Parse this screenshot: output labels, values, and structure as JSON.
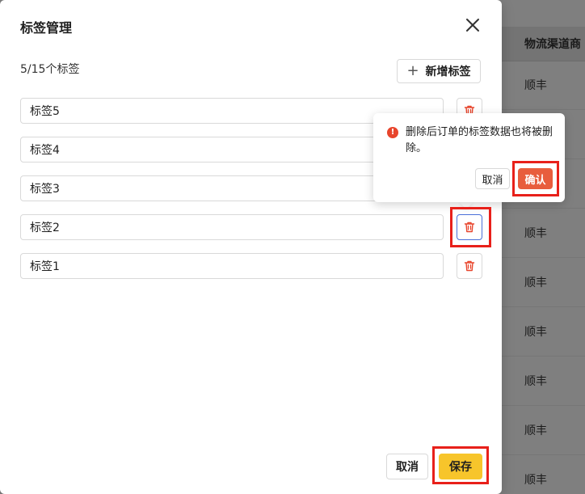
{
  "background_table": {
    "header": "物流渠道商",
    "rows": [
      "顺丰",
      "顺丰",
      "顺丰",
      "顺丰",
      "顺丰",
      "顺丰",
      "顺丰",
      "顺丰",
      "顺丰"
    ]
  },
  "modal": {
    "title": "标签管理",
    "count_text": "5/15个标签",
    "add_button_label": "新增标签",
    "tags": [
      {
        "value": "标签5"
      },
      {
        "value": "标签4"
      },
      {
        "value": "标签3"
      },
      {
        "value": "标签2"
      },
      {
        "value": "标签1"
      }
    ],
    "footer": {
      "cancel_label": "取消",
      "save_label": "保存"
    }
  },
  "popconfirm": {
    "message": "删除后订单的标签数据也将被删除。",
    "cancel_label": "取消",
    "confirm_label": "确认"
  },
  "colors": {
    "primary": "#f7c52b",
    "danger": "#e85d3d",
    "delete_icon": "#e8452c",
    "highlight": "#e8201a"
  },
  "icons": {
    "close": "close-icon",
    "add": "plus-icon",
    "delete": "trash-icon",
    "warning": "exclamation-circle-icon"
  }
}
